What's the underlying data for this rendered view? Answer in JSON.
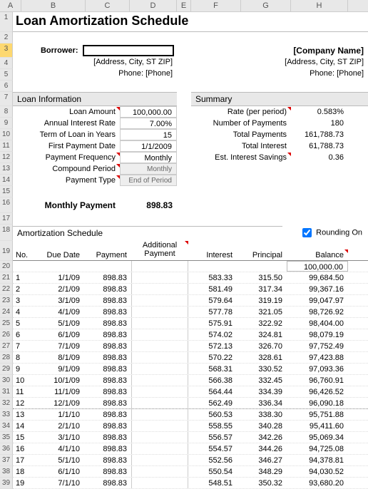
{
  "columns": [
    "A",
    "B",
    "C",
    "D",
    "E",
    "F",
    "G",
    "H"
  ],
  "title": "Loan Amortization Schedule",
  "borrower_label": "Borrower:",
  "borrower_address": "[Address, City, ST ZIP]",
  "borrower_phone": "Phone: [Phone]",
  "company_name": "[Company Name]",
  "company_address": "[Address, City, ST  ZIP]",
  "company_phone": "Phone: [Phone]",
  "loan_info_header": "Loan Information",
  "summary_header": "Summary",
  "loan_info": {
    "amount_label": "Loan Amount",
    "amount_value": "100,000.00",
    "rate_label": "Annual Interest Rate",
    "rate_value": "7.00%",
    "term_label": "Term of Loan in Years",
    "term_value": "15",
    "first_date_label": "First Payment Date",
    "first_date_value": "1/1/2009",
    "freq_label": "Payment Frequency",
    "freq_value": "Monthly",
    "compound_label": "Compound Period",
    "compound_value": "Monthly",
    "type_label": "Payment Type",
    "type_value": "End of Period"
  },
  "summary": {
    "rate_label": "Rate (per period)",
    "rate_value": "0.583%",
    "num_label": "Number of Payments",
    "num_value": "180",
    "total_pay_label": "Total Payments",
    "total_pay_value": "161,788.73",
    "total_int_label": "Total Interest",
    "total_int_value": "61,788.73",
    "savings_label": "Est. Interest Savings",
    "savings_value": "0.36"
  },
  "monthly_label": "Monthly Payment",
  "monthly_value": "898.83",
  "amort_header": "Amortization Schedule",
  "rounding_label": "Rounding On",
  "table_headers": {
    "no": "No.",
    "due": "Due Date",
    "payment": "Payment",
    "additional": "Additional Payment",
    "interest": "Interest",
    "principal": "Principal",
    "balance": "Balance"
  },
  "start_balance": "100,000.00",
  "rows": [
    {
      "n": "1",
      "due": "1/1/09",
      "pay": "898.83",
      "int": "583.33",
      "prin": "315.50",
      "bal": "99,684.50"
    },
    {
      "n": "2",
      "due": "2/1/09",
      "pay": "898.83",
      "int": "581.49",
      "prin": "317.34",
      "bal": "99,367.16"
    },
    {
      "n": "3",
      "due": "3/1/09",
      "pay": "898.83",
      "int": "579.64",
      "prin": "319.19",
      "bal": "99,047.97"
    },
    {
      "n": "4",
      "due": "4/1/09",
      "pay": "898.83",
      "int": "577.78",
      "prin": "321.05",
      "bal": "98,726.92"
    },
    {
      "n": "5",
      "due": "5/1/09",
      "pay": "898.83",
      "int": "575.91",
      "prin": "322.92",
      "bal": "98,404.00"
    },
    {
      "n": "6",
      "due": "6/1/09",
      "pay": "898.83",
      "int": "574.02",
      "prin": "324.81",
      "bal": "98,079.19"
    },
    {
      "n": "7",
      "due": "7/1/09",
      "pay": "898.83",
      "int": "572.13",
      "prin": "326.70",
      "bal": "97,752.49"
    },
    {
      "n": "8",
      "due": "8/1/09",
      "pay": "898.83",
      "int": "570.22",
      "prin": "328.61",
      "bal": "97,423.88"
    },
    {
      "n": "9",
      "due": "9/1/09",
      "pay": "898.83",
      "int": "568.31",
      "prin": "330.52",
      "bal": "97,093.36"
    },
    {
      "n": "10",
      "due": "10/1/09",
      "pay": "898.83",
      "int": "566.38",
      "prin": "332.45",
      "bal": "96,760.91"
    },
    {
      "n": "11",
      "due": "11/1/09",
      "pay": "898.83",
      "int": "564.44",
      "prin": "334.39",
      "bal": "96,426.52"
    },
    {
      "n": "12",
      "due": "12/1/09",
      "pay": "898.83",
      "int": "562.49",
      "prin": "336.34",
      "bal": "96,090.18"
    },
    {
      "n": "13",
      "due": "1/1/10",
      "pay": "898.83",
      "int": "560.53",
      "prin": "338.30",
      "bal": "95,751.88"
    },
    {
      "n": "14",
      "due": "2/1/10",
      "pay": "898.83",
      "int": "558.55",
      "prin": "340.28",
      "bal": "95,411.60"
    },
    {
      "n": "15",
      "due": "3/1/10",
      "pay": "898.83",
      "int": "556.57",
      "prin": "342.26",
      "bal": "95,069.34"
    },
    {
      "n": "16",
      "due": "4/1/10",
      "pay": "898.83",
      "int": "554.57",
      "prin": "344.26",
      "bal": "94,725.08"
    },
    {
      "n": "17",
      "due": "5/1/10",
      "pay": "898.83",
      "int": "552.56",
      "prin": "346.27",
      "bal": "94,378.81"
    },
    {
      "n": "18",
      "due": "6/1/10",
      "pay": "898.83",
      "int": "550.54",
      "prin": "348.29",
      "bal": "94,030.52"
    },
    {
      "n": "19",
      "due": "7/1/10",
      "pay": "898.83",
      "int": "548.51",
      "prin": "350.32",
      "bal": "93,680.20"
    }
  ]
}
